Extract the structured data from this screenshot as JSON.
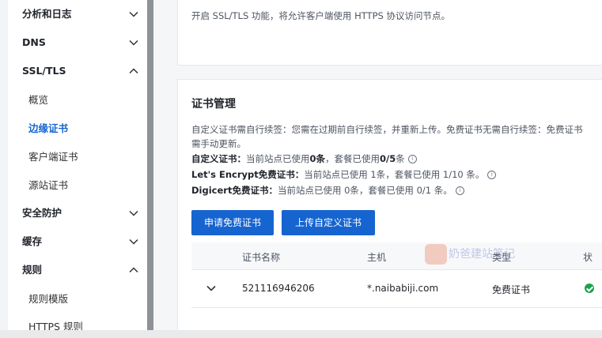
{
  "sidebar": {
    "items": [
      {
        "label": "分析和日志",
        "chevron": "down"
      },
      {
        "label": "DNS",
        "chevron": "down"
      },
      {
        "label": "SSL/TLS",
        "chevron": "up"
      },
      {
        "label": "安全防护",
        "chevron": "down"
      },
      {
        "label": "缓存",
        "chevron": "down"
      },
      {
        "label": "规则",
        "chevron": "up"
      }
    ],
    "ssl_sub": [
      "概览",
      "边缘证书",
      "客户端证书",
      "源站证书"
    ],
    "rules_sub": [
      "规则模版",
      "HTTPS 规则"
    ],
    "active_sub": "边缘证书"
  },
  "ssl_card": {
    "description": "开启 SSL/TLS 功能，将允许客户端使用 HTTPS 协议访问节点。"
  },
  "cert_card": {
    "title": "证书管理",
    "note_line1": "自定义证书需自行续签：您需在过期前自行续签，并重新上传。免费证书无需自行续签：免费证书",
    "note_line2": "需手动更新。",
    "custom_label": "自定义证书：",
    "custom_text": "当前站点已使用",
    "custom_count": "0条",
    "custom_rest": "，套餐已使用",
    "custom_quota": "0/5",
    "custom_unit": "条",
    "le_label": "Let's Encrypt免费证书：",
    "le_text": "当前站点已使用 1条，套餐已使用 1/10 条。",
    "digicert_label": "Digicert免费证书：",
    "digicert_text": "当前站点已使用 0条，套餐已使用 0/1 条。",
    "btn_apply": "申请免费证书",
    "btn_upload": "上传自定义证书",
    "columns": [
      "证书名称",
      "主机",
      "类型",
      "状"
    ],
    "row": {
      "name": "521116946206",
      "host": "*.naibabiji.com",
      "type": "免费证书",
      "status": "active"
    }
  },
  "watermark": "奶爸建站笔记",
  "colors": {
    "primary": "#1664d0",
    "success": "#1aa34a"
  }
}
